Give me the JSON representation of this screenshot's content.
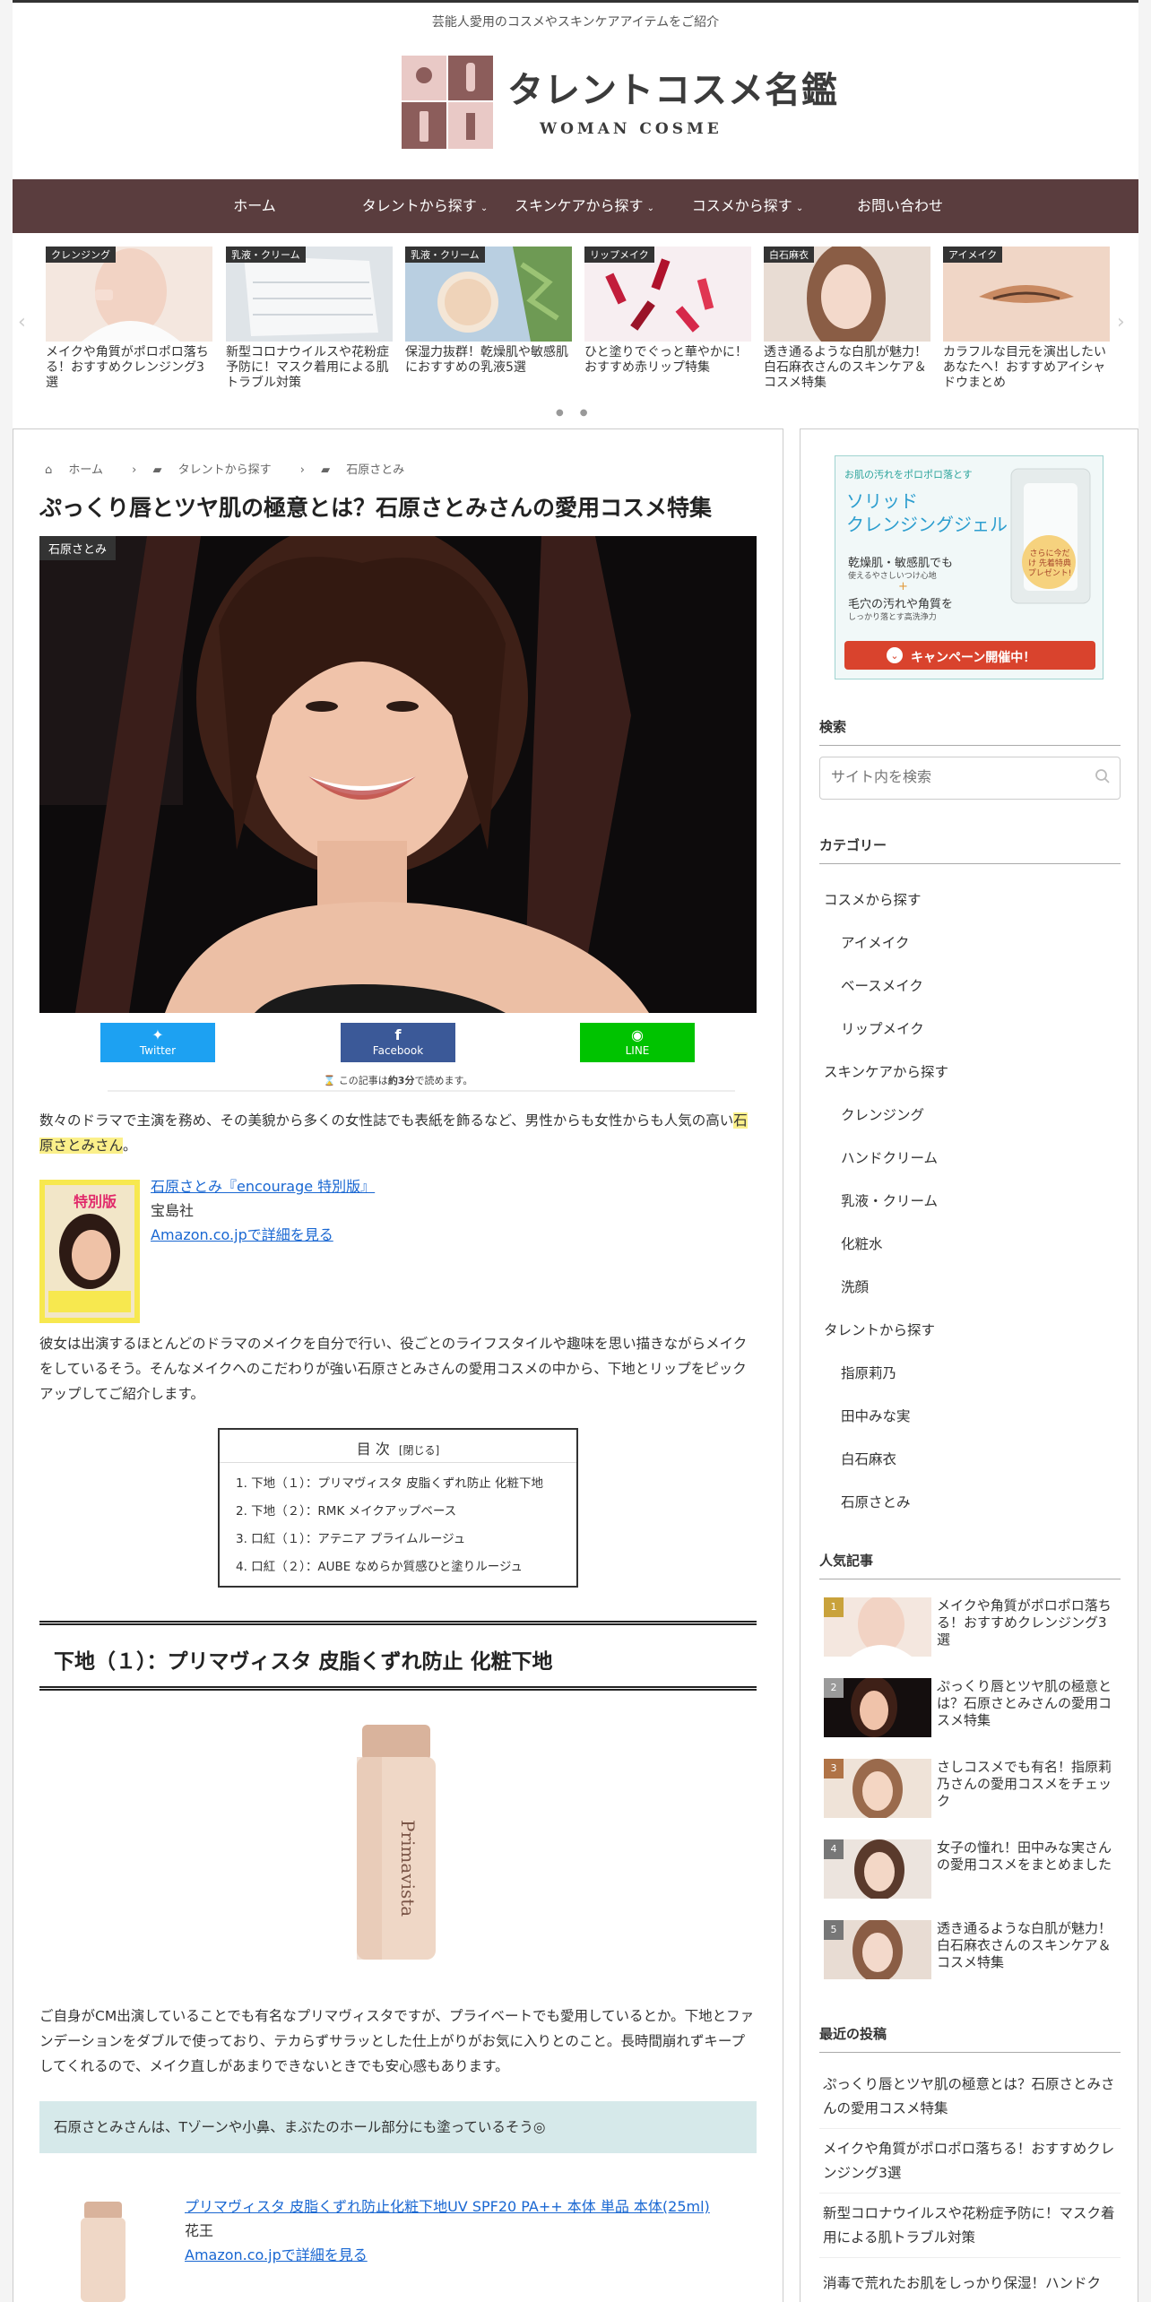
{
  "header": {
    "tagline": "芸能人愛用のコスメやスキンケアアイテムをご紹介",
    "logo_text": "タレントコスメ名鑑",
    "logo_sub": "WOMAN COSME"
  },
  "nav": [
    {
      "label": "ホーム",
      "caret": ""
    },
    {
      "label": "タレントから探す",
      "caret": "⌄"
    },
    {
      "label": "スキンケアから探す",
      "caret": "⌄"
    },
    {
      "label": "コスメから探す",
      "caret": "⌄"
    },
    {
      "label": "お問い合わせ",
      "caret": ""
    }
  ],
  "carousel": [
    {
      "tag": "クレンジング",
      "title": "メイクや角質がポロポロ落ちる！おすすめクレンジング3選"
    },
    {
      "tag": "乳液・クリーム",
      "title": "新型コロナウイルスや花粉症予防に！マスク着用による肌トラブル対策"
    },
    {
      "tag": "乳液・クリーム",
      "title": "保湿力抜群！乾燥肌や敏感肌におすすめの乳液5選"
    },
    {
      "tag": "リップメイク",
      "title": "ひと塗りでぐっと華やかに！おすすめ赤リップ特集"
    },
    {
      "tag": "白石麻衣",
      "title": "透き通るような白肌が魅力！白石麻衣さんのスキンケア＆コスメ特集"
    },
    {
      "tag": "アイメイク",
      "title": "カラフルな目元を演出したいあなたへ！おすすめアイシャドウまとめ"
    }
  ],
  "breadcrumb": [
    "ホーム",
    "タレントから探す",
    "石原さとみ"
  ],
  "article": {
    "title": "ぷっくり唇とツヤ肌の極意とは？石原さとみさんの愛用コスメ特集",
    "hero_tag": "石原さとみ",
    "share": {
      "twitter": "Twitter",
      "facebook": "Facebook",
      "line": "LINE"
    },
    "read_pre": "この記事は",
    "read_bold": "約3分",
    "read_post": "で読めます。",
    "intro": "数々のドラマで主演を務め、その美貌から多くの女性誌でも表紙を飾るなど、男性からも女性からも人気の高い",
    "intro_hl": "石原さとみさん",
    "intro_end": "。",
    "book": {
      "cover_label": "特別版",
      "title": "石原さとみ『encourage 特別版』",
      "publisher": "宝島社",
      "link": "Amazon.co.jpで詳細を見る"
    },
    "para2": "彼女は出演するほとんどのドラマのメイクを自分で行い、役ごとのライフスタイルや趣味を思い描きながらメイクをしているそう。そんなメイクへのこだわりが強い石原さとみさんの愛用コスメの中から、下地とリップをピックアップしてご紹介します。",
    "toc": {
      "title": "目 次",
      "toggle": "[閉じる]",
      "items": [
        "1. 下地（１）：プリマヴィスタ 皮脂くずれ防止 化粧下地",
        "2. 下地（２）：RMK メイクアップベース",
        "3. 口紅（１）：アテニア プライムルージュ",
        "4. 口紅（２）：AUBE なめらか質感ひと塗りルージュ"
      ]
    },
    "h2": "下地（１）：プリマヴィスタ 皮脂くずれ防止 化粧下地",
    "product_label": "Primavista",
    "para3": "ご自身がCM出演していることでも有名なプリマヴィスタですが、プライベートでも愛用しているとか。下地とファンデーションをダブルで使っており、テカらずサラッとした仕上がりがお気に入りとのこと。長時間崩れずキープしてくれるので、メイク直しがあまりできないときでも安心感もあります。",
    "note": "石原さとみさんは、Tゾーンや小鼻、まぶたのホール部分にも塗っているそう◎",
    "product2": {
      "title": "プリマヴィスタ 皮脂くずれ防止化粧下地UV SPF20 PA++ 本体 単品 本体(25ml)",
      "brand": "花王",
      "link": "Amazon.co.jpで詳細を見る"
    }
  },
  "sidebar": {
    "ad": {
      "top": "お肌の汚れをポロポロ落とす",
      "name1": "ソリッド",
      "name2": "クレンジングジェル",
      "line1": "乾燥肌・敏感肌でも",
      "line1b": "使えるやさしいつけ心地",
      "plus": "+",
      "line2": "毛穴の汚れや角質を",
      "line2b": "しっかり落とす高洗浄力",
      "badge": "さらに今だけ 先着特典 プレゼント!",
      "cta": "キャンペーン開催中！"
    },
    "search": {
      "heading": "検索",
      "placeholder": "サイト内を検索"
    },
    "category": {
      "heading": "カテゴリー",
      "items": [
        "コスメから探す",
        "アイメイク",
        "ベースメイク",
        "リップメイク",
        "スキンケアから探す",
        "クレンジング",
        "ハンドクリーム",
        "乳液・クリーム",
        "化粧水",
        "洗顔",
        "タレントから探す",
        "指原莉乃",
        "田中みな実",
        "白石麻衣",
        "石原さとみ"
      ]
    },
    "popular": {
      "heading": "人気記事",
      "items": [
        {
          "rank": "1",
          "title": "メイクや角質がポロポロ落ちる！おすすめクレンジング3選"
        },
        {
          "rank": "2",
          "title": "ぷっくり唇とツヤ肌の極意とは？石原さとみさんの愛用コスメ特集"
        },
        {
          "rank": "3",
          "title": "さしコスメでも有名！指原莉乃さんの愛用コスメをチェック"
        },
        {
          "rank": "4",
          "title": "女子の憧れ！田中みな実さんの愛用コスメをまとめました"
        },
        {
          "rank": "5",
          "title": "透き通るような白肌が魅力！白石麻衣さんのスキンケア＆コスメ特集"
        }
      ]
    },
    "recent": {
      "heading": "最近の投稿",
      "items": [
        "ぷっくり唇とツヤ肌の極意とは？石原さとみさんの愛用コスメ特集",
        "メイクや角質がポロポロ落ちる！おすすめクレンジング3選",
        "新型コロナウイルスや花粉症予防に！マスク着用による肌トラブル対策",
        "消毒で荒れたお肌をしっかり保湿！ハンドク"
      ]
    }
  },
  "colors": {
    "nav": "#5a3d3e",
    "twitter": "#1da1f2",
    "facebook": "#3b5998",
    "line": "#00c300",
    "highlight": "#fbf08a",
    "note_bg": "#d6e9ea"
  }
}
